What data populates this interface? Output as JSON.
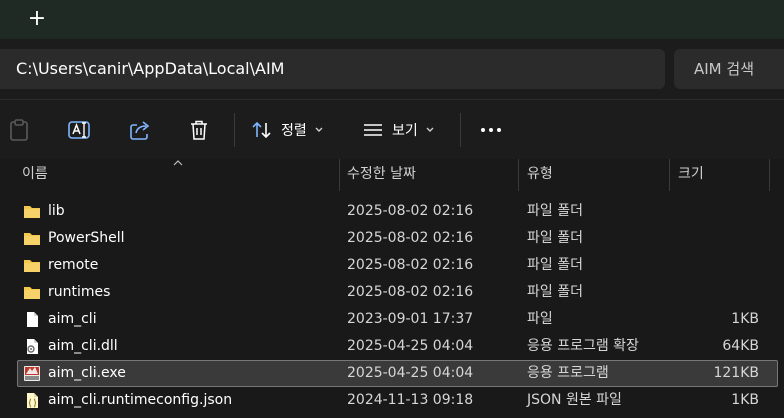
{
  "tabbar": {
    "new_tab_symbol": "+"
  },
  "address": {
    "path": "C:\\Users\\canir\\AppData\\Local\\AIM"
  },
  "search": {
    "placeholder": "AIM 검색"
  },
  "commands": {
    "paste_icon": "clipboard-icon",
    "rename_icon": "rename-icon",
    "share_icon": "share-icon",
    "delete_icon": "trash-icon",
    "sort_label": "정렬",
    "view_label": "보기",
    "more_icon": "more-icon"
  },
  "columns": {
    "name": "이름",
    "date": "수정한 날짜",
    "type": "유형",
    "size": "크기"
  },
  "files": [
    {
      "name": "lib",
      "date": "2025-08-02 02:16",
      "type": "파일 폴더",
      "size": "",
      "icon": "folder-icon"
    },
    {
      "name": "PowerShell",
      "date": "2025-08-02 02:16",
      "type": "파일 폴더",
      "size": "",
      "icon": "folder-icon"
    },
    {
      "name": "remote",
      "date": "2025-08-02 02:16",
      "type": "파일 폴더",
      "size": "",
      "icon": "folder-icon"
    },
    {
      "name": "runtimes",
      "date": "2025-08-02 02:16",
      "type": "파일 폴더",
      "size": "",
      "icon": "folder-icon"
    },
    {
      "name": "aim_cli",
      "date": "2023-09-01 17:37",
      "type": "파일",
      "size": "1KB",
      "icon": "file-icon"
    },
    {
      "name": "aim_cli.dll",
      "date": "2025-04-25 04:04",
      "type": "응용 프로그램 확장",
      "size": "64KB",
      "icon": "dll-icon"
    },
    {
      "name": "aim_cli.exe",
      "date": "2025-04-25 04:04",
      "type": "응용 프로그램",
      "size": "121KB",
      "icon": "exe-icon",
      "selected": true
    },
    {
      "name": "aim_cli.runtimeconfig.json",
      "date": "2024-11-13 09:18",
      "type": "JSON 원본 파일",
      "size": "1KB",
      "icon": "json-icon"
    }
  ],
  "colors": {
    "folder": "#f4c84a",
    "accent_blue": "#7fb6ff",
    "selection_border": "#777777"
  }
}
